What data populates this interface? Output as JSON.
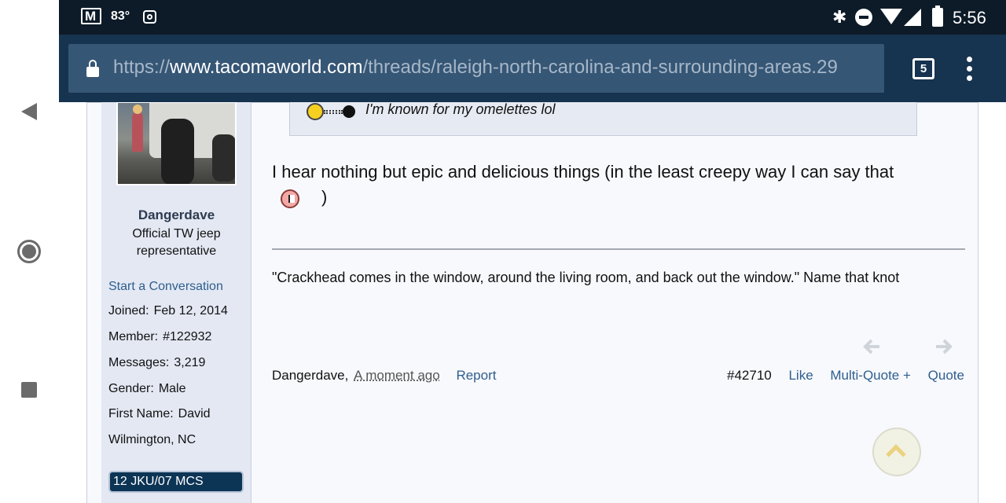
{
  "status_bar": {
    "temperature": "83°",
    "time": "5:56",
    "icons": [
      "gmail-icon",
      "instagram-icon",
      "bluetooth-icon",
      "do-not-disturb-icon",
      "wifi-icon",
      "signal-icon",
      "battery-icon"
    ]
  },
  "browser": {
    "url_scheme": "https://",
    "url_domain": "www.tacomaworld.com",
    "url_path": "/threads/raleigh-north-carolina-and-surrounding-areas.29",
    "tab_count": "5"
  },
  "user": {
    "name": "Dangerdave",
    "title": "Official TW jeep representative",
    "start_conversation": "Start a Conversation",
    "stats": [
      {
        "label": "Joined:",
        "value": "Feb 12, 2014"
      },
      {
        "label": "Member:",
        "value": "#122932"
      },
      {
        "label": "Messages:",
        "value": "3,219"
      },
      {
        "label": "Gender:",
        "value": "Male"
      },
      {
        "label": "First Name:",
        "value": "David"
      }
    ],
    "location": "Wilmington, NC",
    "banner": "12 JKU/07 MCS"
  },
  "post": {
    "quote_text": "I'm known for my omelettes lol",
    "body_text": "I hear nothing but epic and delicious things (in the least creepy way I can say that",
    "body_close": ")",
    "signature": "\"Crackhead comes in the window, around the living room, and back out the window.\" Name that knot",
    "author": "Dangerdave,",
    "time": "A moment ago",
    "report": "Report",
    "post_number": "#42710",
    "like": "Like",
    "multi_quote": "Multi-Quote +",
    "quote": "Quote"
  },
  "colors": {
    "status_bar": "#0d1b28",
    "browser_bar": "#16334f",
    "link": "#2e5e8e",
    "user_panel": "#e3e8f3",
    "banner": "#0c3455"
  }
}
